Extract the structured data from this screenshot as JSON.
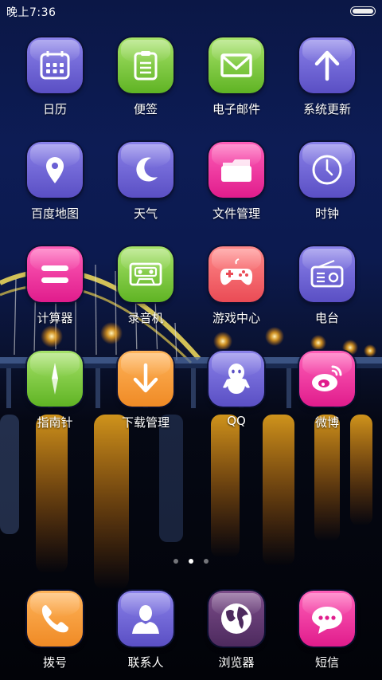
{
  "status_bar": {
    "time": "晚上7:36"
  },
  "home": {
    "rows": [
      [
        {
          "name": "calendar",
          "label": "日历",
          "color": "purple",
          "icon": "calendar-icon"
        },
        {
          "name": "notes",
          "label": "便签",
          "color": "green",
          "icon": "clipboard-icon"
        },
        {
          "name": "email",
          "label": "电子邮件",
          "color": "green",
          "icon": "envelope-icon"
        },
        {
          "name": "system-update",
          "label": "系统更新",
          "color": "purple",
          "icon": "arrow-up-icon"
        }
      ],
      [
        {
          "name": "baidu-map",
          "label": "百度地图",
          "color": "purple",
          "icon": "map-pin-icon"
        },
        {
          "name": "weather",
          "label": "天气",
          "color": "purple",
          "icon": "moon-icon"
        },
        {
          "name": "file-manager",
          "label": "文件管理",
          "color": "pink",
          "icon": "folder-icon"
        },
        {
          "name": "clock",
          "label": "时钟",
          "color": "purple",
          "icon": "clock-icon"
        }
      ],
      [
        {
          "name": "calculator",
          "label": "计算器",
          "color": "pink",
          "icon": "equals-icon"
        },
        {
          "name": "recorder",
          "label": "录音机",
          "color": "green",
          "icon": "cassette-icon"
        },
        {
          "name": "game-center",
          "label": "游戏中心",
          "color": "coral",
          "icon": "gamepad-icon"
        },
        {
          "name": "radio",
          "label": "电台",
          "color": "purple",
          "icon": "radio-icon"
        }
      ],
      [
        {
          "name": "compass",
          "label": "指南针",
          "color": "green",
          "icon": "compass-icon"
        },
        {
          "name": "download-manager",
          "label": "下载管理",
          "color": "orange",
          "icon": "download-arrow-icon"
        },
        {
          "name": "qq",
          "label": "QQ",
          "color": "purple",
          "icon": "penguin-icon"
        },
        {
          "name": "weibo",
          "label": "微博",
          "color": "pink",
          "icon": "weibo-icon"
        }
      ]
    ]
  },
  "page_indicator": {
    "count": 3,
    "active": 1
  },
  "dock": [
    {
      "name": "dialer",
      "label": "拨号",
      "color": "orange",
      "icon": "phone-icon"
    },
    {
      "name": "contacts",
      "label": "联系人",
      "color": "purple",
      "icon": "person-icon"
    },
    {
      "name": "browser",
      "label": "浏览器",
      "color": "violet",
      "icon": "globe-icon"
    },
    {
      "name": "messages",
      "label": "短信",
      "color": "pink",
      "icon": "chat-bubble-icon"
    }
  ]
}
